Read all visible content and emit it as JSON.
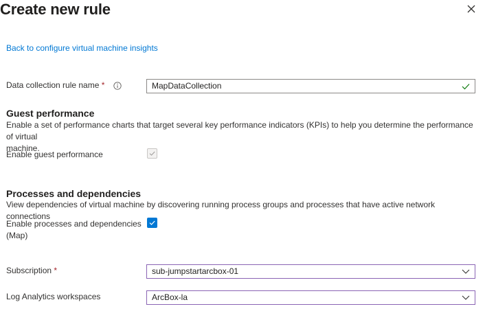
{
  "header": {
    "title": "Create new rule"
  },
  "back_link": "Back to configure virtual machine insights",
  "dcr": {
    "label": "Data collection rule name",
    "required_mark": "*",
    "value": "MapDataCollection"
  },
  "guest": {
    "heading": "Guest performance",
    "description_line1": "Enable a set of performance charts that target several key performance indicators (KPIs) to help you determine the performance of virtual",
    "description_line2": "machine.",
    "toggle_label": "Enable guest performance",
    "checked": true,
    "disabled": true
  },
  "processes": {
    "heading": "Processes and dependencies",
    "description": "View dependencies of virtual machine by discovering running process groups and processes that have active network connections",
    "toggle_label_line1": "Enable processes and dependencies",
    "toggle_label_line2": "(Map)",
    "checked": true
  },
  "subscription": {
    "label": "Subscription",
    "required_mark": "*",
    "value": "sub-jumpstartarcbox-01"
  },
  "workspace": {
    "label": "Log Analytics workspaces",
    "value": "ArcBox-la"
  },
  "icons": [
    "close-icon",
    "info-icon",
    "checkmark-icon",
    "chevron-down-icon"
  ],
  "colors": {
    "link": "#0078d4",
    "required": "#a4262c",
    "valid": "#107c10",
    "focus_border": "#8a63b4",
    "checkbox_on": "#0078d4"
  }
}
